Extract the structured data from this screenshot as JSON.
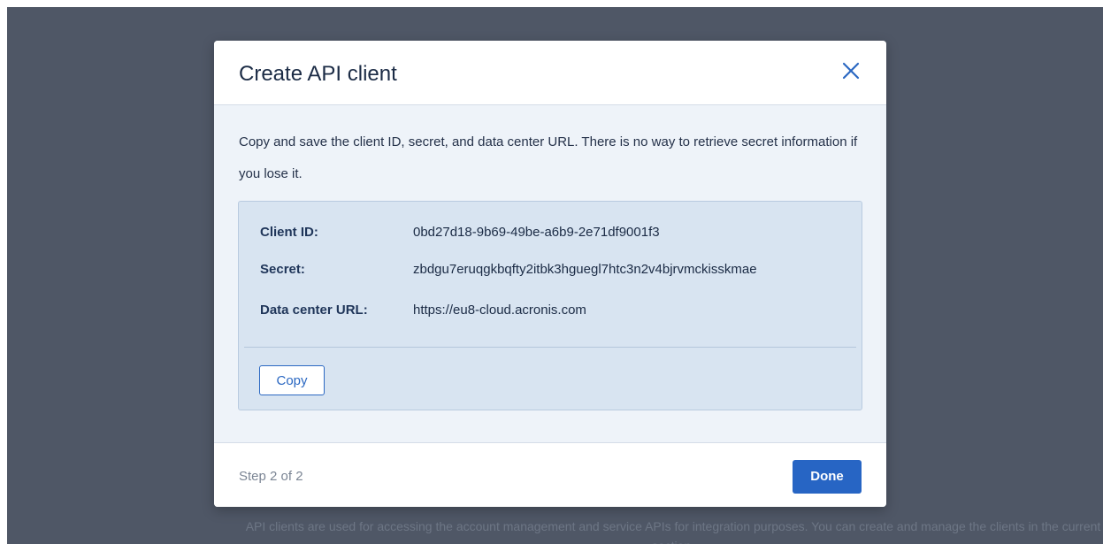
{
  "background": {
    "description_text": "API clients are used for accessing the account management and service APIs for integration purposes. You can create and manage the clients in the current section."
  },
  "modal": {
    "title": "Create API client",
    "close_icon": "close-icon",
    "intro_text": "Copy and save the client ID, secret, and data center URL. There is no way to retrieve secret information if you lose it.",
    "fields": [
      {
        "label": "Client ID:",
        "value": "0bd27d18-9b69-49be-a6b9-2e71df9001f3"
      },
      {
        "label": "Secret:",
        "value": "zbdgu7eruqgkbqfty2itbk3hguegl7htc3n2v4bjrvmckisskmae"
      },
      {
        "label": "Data center URL:",
        "value": "https://eu8-cloud.acronis.com"
      }
    ],
    "copy_label": "Copy",
    "step_text": "Step 2 of 2",
    "done_label": "Done"
  },
  "colors": {
    "overlay": "#4f5766",
    "accent": "#2765c4",
    "info_box": "#d8e4f1"
  }
}
